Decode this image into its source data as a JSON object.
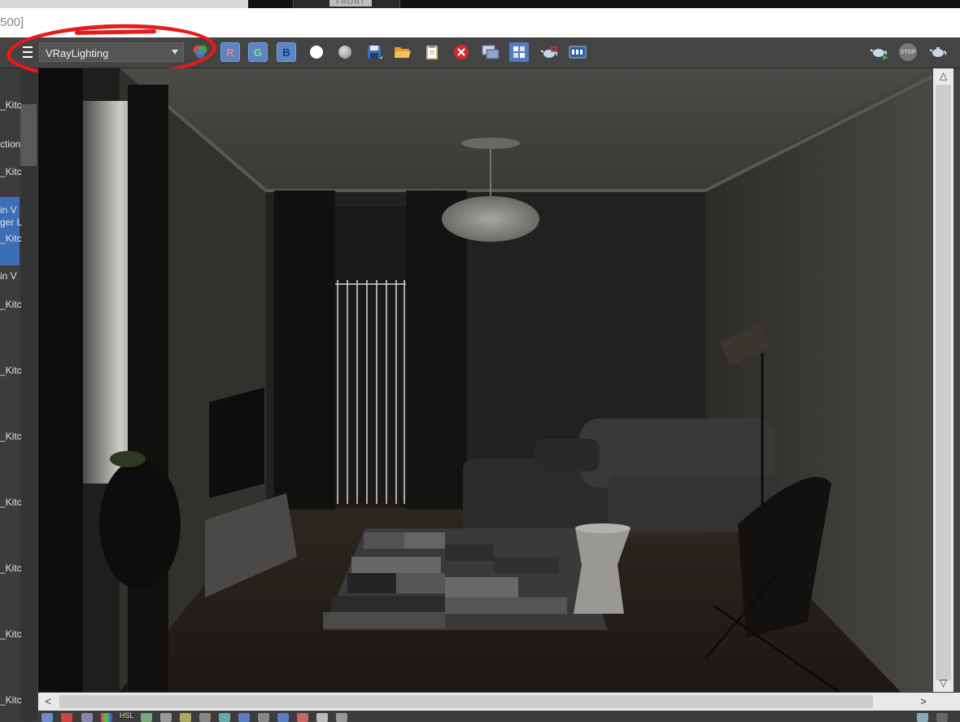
{
  "window": {
    "title_fragment": "500]",
    "viewport_label_fragment": "FRONT"
  },
  "left_panel": {
    "items": [
      "_Kitc",
      "ction",
      "_Kitc",
      "in V",
      "ger L",
      "_Kitc",
      "in V",
      "_Kitc",
      "_Kitc",
      "_Kitc",
      "_Kitc",
      "_Kitc",
      "_Kitc",
      "_Kitc"
    ]
  },
  "toolbar": {
    "menu_icon": "hamburger-icon",
    "render_element": {
      "selected": "VRayLighting"
    },
    "buttons": [
      {
        "name": "color-channels-icon"
      },
      {
        "name": "red-channel-button",
        "label": "R"
      },
      {
        "name": "green-channel-button",
        "label": "G"
      },
      {
        "name": "blue-channel-button",
        "label": "B"
      },
      {
        "name": "white-circle-icon"
      },
      {
        "name": "gray-circle-icon"
      },
      {
        "name": "save-icon"
      },
      {
        "name": "folder-open-icon"
      },
      {
        "name": "clipboard-icon"
      },
      {
        "name": "clear-icon"
      },
      {
        "name": "window-icon"
      },
      {
        "name": "track-mouse-icon"
      },
      {
        "name": "teapot-region-icon"
      },
      {
        "name": "vfb-history-icon"
      }
    ],
    "right_buttons": [
      {
        "name": "render-teapot-icon"
      },
      {
        "name": "stop-button",
        "label": "STOP"
      },
      {
        "name": "teapot-icon"
      }
    ]
  },
  "status_bar": {
    "items": [
      "HSL"
    ]
  },
  "colors": {
    "annotation": "#e81a1a",
    "toolbar_bg": "#444444",
    "channel_button": "#5a86c4"
  }
}
